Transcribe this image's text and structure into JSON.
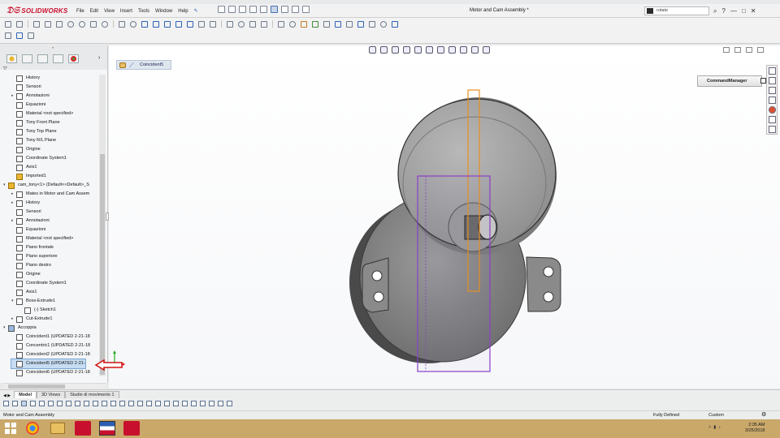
{
  "titlebar": {
    "brand": "SOLIDWORKS",
    "menu": [
      "File",
      "Edit",
      "View",
      "Insert",
      "Tools",
      "Window",
      "Help"
    ],
    "document_title": "Motor and Cam Assembly *",
    "search_value": "rotate",
    "help_label": "?",
    "controls": [
      "—",
      "□",
      "✕"
    ]
  },
  "tree": [
    {
      "indent": 1,
      "exp": "",
      "label": "History"
    },
    {
      "indent": 1,
      "exp": "",
      "label": "Sensori"
    },
    {
      "indent": 1,
      "exp": "▸",
      "label": "Annotazioni"
    },
    {
      "indent": 1,
      "exp": "",
      "label": "Equazioni"
    },
    {
      "indent": 1,
      "exp": "",
      "label": "Material <not specified>"
    },
    {
      "indent": 1,
      "exp": "",
      "label": "Tony Front Plane"
    },
    {
      "indent": 1,
      "exp": "",
      "label": "Tony Top Plane"
    },
    {
      "indent": 1,
      "exp": "",
      "label": "Tony R/L Plane"
    },
    {
      "indent": 1,
      "exp": "",
      "label": "Origine"
    },
    {
      "indent": 1,
      "exp": "",
      "label": "Coordinate System1"
    },
    {
      "indent": 1,
      "exp": "",
      "label": "Axis1"
    },
    {
      "indent": 1,
      "exp": "",
      "label": "Imported1"
    },
    {
      "indent": 0,
      "exp": "▾",
      "label": "cam_tony<1> (Default<<Default>_S"
    },
    {
      "indent": 1,
      "exp": "▸",
      "label": "Mates in Motor and Cam Assem"
    },
    {
      "indent": 1,
      "exp": "▸",
      "label": "History"
    },
    {
      "indent": 1,
      "exp": "",
      "label": "Sensori"
    },
    {
      "indent": 1,
      "exp": "▸",
      "label": "Annotazioni"
    },
    {
      "indent": 1,
      "exp": "",
      "label": "Equazioni"
    },
    {
      "indent": 1,
      "exp": "",
      "label": "Material <not specified>"
    },
    {
      "indent": 1,
      "exp": "",
      "label": "Piano frontale"
    },
    {
      "indent": 1,
      "exp": "",
      "label": "Piano superiore"
    },
    {
      "indent": 1,
      "exp": "",
      "label": "Piano destro"
    },
    {
      "indent": 1,
      "exp": "",
      "label": "Origine"
    },
    {
      "indent": 1,
      "exp": "",
      "label": "Coordinate System1"
    },
    {
      "indent": 1,
      "exp": "",
      "label": "Axis1"
    },
    {
      "indent": 1,
      "exp": "▾",
      "label": "Boss-Extrude1"
    },
    {
      "indent": 2,
      "exp": "",
      "label": "(-) Sketch1"
    },
    {
      "indent": 1,
      "exp": "▸",
      "label": "Cut-Extrude1"
    },
    {
      "indent": 0,
      "exp": "▾",
      "label": "Accoppia"
    },
    {
      "indent": 1,
      "exp": "",
      "label": "Coincident1 (UPDATED 2-21-18"
    },
    {
      "indent": 1,
      "exp": "",
      "label": "Concentric1 (UPDATED 2-21-18"
    },
    {
      "indent": 1,
      "exp": "",
      "label": "Coincident2 (UPDATED 2-21-18"
    },
    {
      "indent": 1,
      "exp": "",
      "label": "Coincident5 (UPDATED 2-21-",
      "selected": true
    },
    {
      "indent": 1,
      "exp": "",
      "label": "Coincident6 (UPDATED 2-21-18"
    }
  ],
  "viewport": {
    "breadcrumb_label": "Coincident5",
    "command_manager_label": "CommandManager"
  },
  "bottom_tabs": [
    "Model",
    "3D Views",
    "Studio di movimento 1"
  ],
  "status": {
    "left": "Motor and Cam Assembly",
    "state": "Fully Defined",
    "units": "Custom"
  },
  "taskbar": {
    "time": "2:35 AM",
    "date": "3/25/2018"
  },
  "colors": {
    "accent": "#c8102e",
    "selection_blue": "#c6dcf2",
    "mate_orange": "#e8901e",
    "mate_purple": "#8a3fc8",
    "desktop": "#c9a86a"
  }
}
